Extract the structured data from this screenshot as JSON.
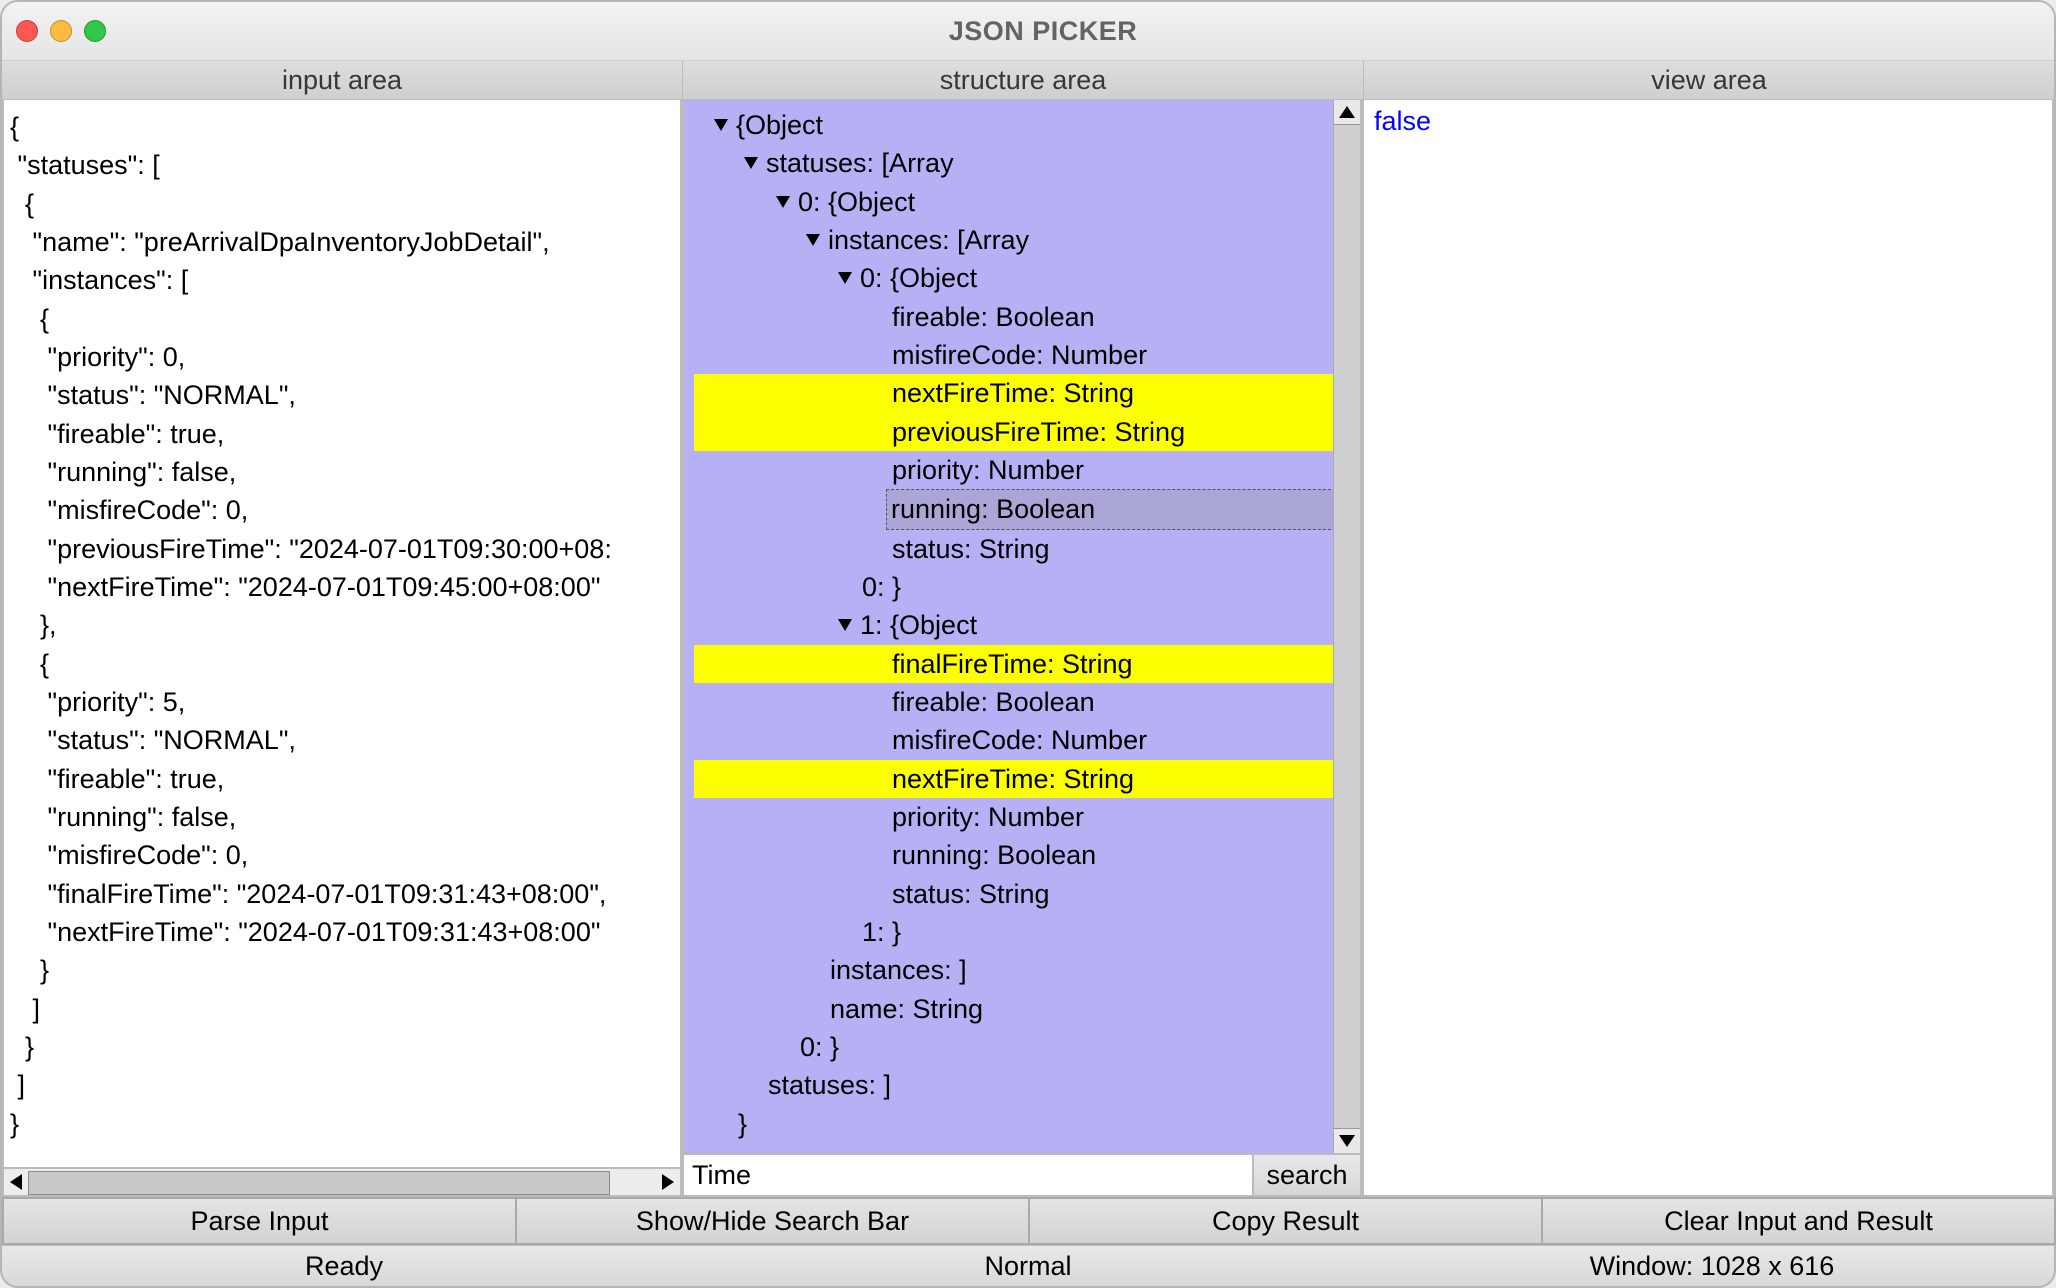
{
  "window": {
    "title": "JSON PICKER"
  },
  "headers": {
    "input": "input area",
    "structure": "structure area",
    "view": "view area"
  },
  "input_text": "{\n \"statuses\": [\n  {\n   \"name\": \"preArrivalDpaInventoryJobDetail\",\n   \"instances\": [\n    {\n     \"priority\": 0,\n     \"status\": \"NORMAL\",\n     \"fireable\": true,\n     \"running\": false,\n     \"misfireCode\": 0,\n     \"previousFireTime\": \"2024-07-01T09:30:00+08:\n     \"nextFireTime\": \"2024-07-01T09:45:00+08:00\"\n    },\n    {\n     \"priority\": 5,\n     \"status\": \"NORMAL\",\n     \"fireable\": true,\n     \"running\": false,\n     \"misfireCode\": 0,\n     \"finalFireTime\": \"2024-07-01T09:31:43+08:00\",\n     \"nextFireTime\": \"2024-07-01T09:31:43+08:00\"\n    }\n   ]\n  }\n ]\n}",
  "tree": {
    "n0": "{Object",
    "n1": "statuses: [Array",
    "n2": "0: {Object",
    "n3": "instances: [Array",
    "n4": "0: {Object",
    "n5": "fireable: Boolean",
    "n6": "misfireCode: Number",
    "n7": "nextFireTime: String",
    "n8": "previousFireTime: String",
    "n9": "priority: Number",
    "n10": "running: Boolean",
    "n11": "status: String",
    "n12": "0: }",
    "n13": "1: {Object",
    "n14": "finalFireTime: String",
    "n15": "fireable: Boolean",
    "n16": "misfireCode: Number",
    "n17": "nextFireTime: String",
    "n18": "priority: Number",
    "n19": "running: Boolean",
    "n20": "status: String",
    "n21": "1: }",
    "n22": "instances: ]",
    "n23": "name: String",
    "n24": "0: }",
    "n25": "statuses: ]",
    "n26": "}"
  },
  "search": {
    "value": "Time",
    "button": "search"
  },
  "view": {
    "value": "false"
  },
  "buttons": {
    "parse": "Parse Input",
    "toggle_search": "Show/Hide Search Bar",
    "copy": "Copy Result",
    "clear": "Clear Input and Result"
  },
  "status": {
    "left": "Ready",
    "center": "Normal",
    "right": "Window: 1028 x 616"
  }
}
